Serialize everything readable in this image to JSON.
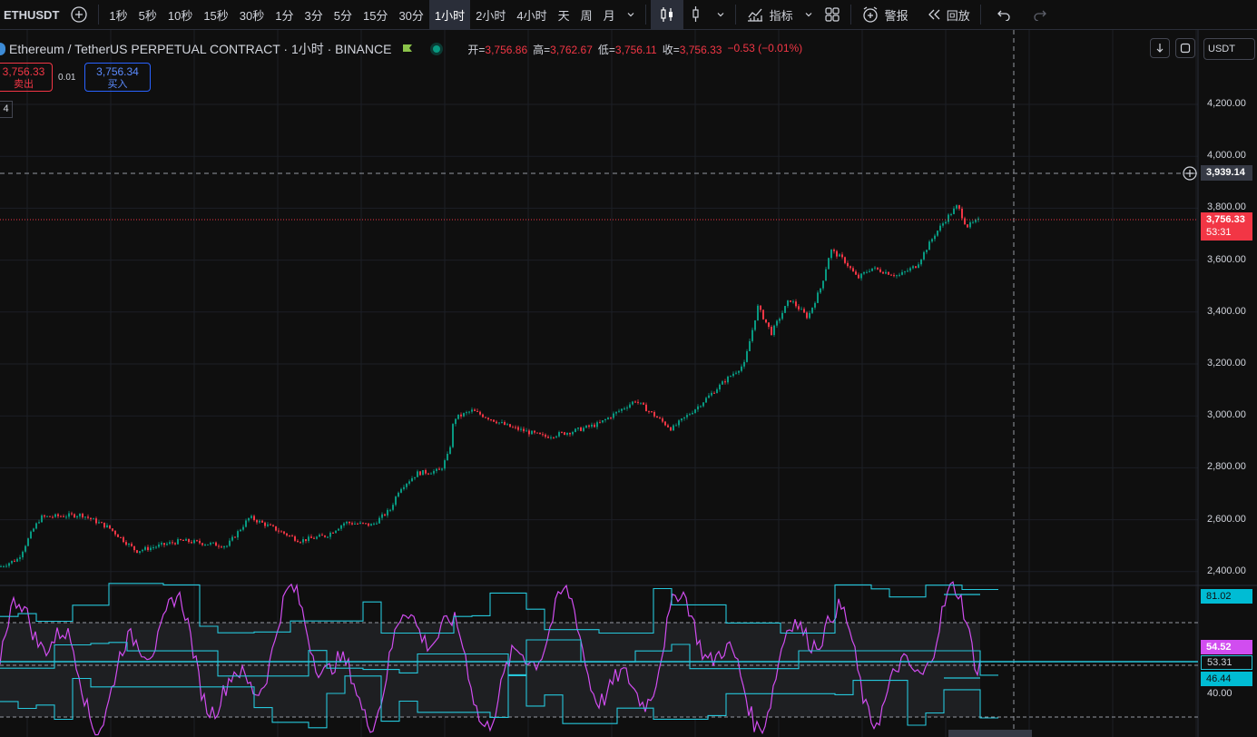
{
  "toolbar": {
    "symbol": "ETHUSDT",
    "intervals": [
      "1秒",
      "5秒",
      "10秒",
      "15秒",
      "30秒",
      "1分",
      "3分",
      "5分",
      "15分",
      "30分",
      "1小时",
      "2小时",
      "4小时",
      "天",
      "周",
      "月"
    ],
    "active_interval": "1小时",
    "indicators_label": "指标",
    "alert_label": "警报",
    "replay_label": "回放"
  },
  "legend": {
    "title": "Ethereum / TetherUS PERPETUAL CONTRACT · 1小时 · BINANCE",
    "open_label": "开=",
    "open": "3,756.86",
    "high_label": "高=",
    "high": "3,762.67",
    "low_label": "低=",
    "low": "3,756.11",
    "close_label": "收=",
    "close": "3,756.33",
    "change": "−0.53 (−0.01%)"
  },
  "trade": {
    "sell_price": "3,756.33",
    "sell_label": "卖出",
    "spread": "0.01",
    "buy_price": "3,756.34",
    "buy_label": "买入",
    "badge": "4"
  },
  "currency": "USDT",
  "price_axis": [
    "4,200.00",
    "4,000.00",
    "3,800.00",
    "3,600.00",
    "3,400.00",
    "3,200.00",
    "3,000.00",
    "2,800.00",
    "2,600.00",
    "2,400.00"
  ],
  "tags": {
    "crosshair_price": "3,939.14",
    "last_price": "3,756.33",
    "countdown": "53:31",
    "ind_upper": "81.02",
    "ind_rsi": "54.52",
    "ind_mid": "53.31",
    "ind_lower": "46.44",
    "ind_axis": "40.00"
  },
  "colors": {
    "up": "#089981",
    "down": "#f23645",
    "rsi": "#d14df0",
    "band": "#26c6da"
  },
  "chart_data": {
    "type": "candlestick",
    "ylim": [
      2350,
      4300
    ],
    "start": 2420,
    "end": 3756.33,
    "crosshair": 3939.14,
    "last": 3756.33,
    "indicator": {
      "ylim": [
        30,
        90
      ],
      "upper_last": 81.02,
      "mid_last": 53.31,
      "lower_last": 46.44,
      "rsi_last": 54.52,
      "levels": [
        70,
        50,
        30
      ]
    }
  }
}
